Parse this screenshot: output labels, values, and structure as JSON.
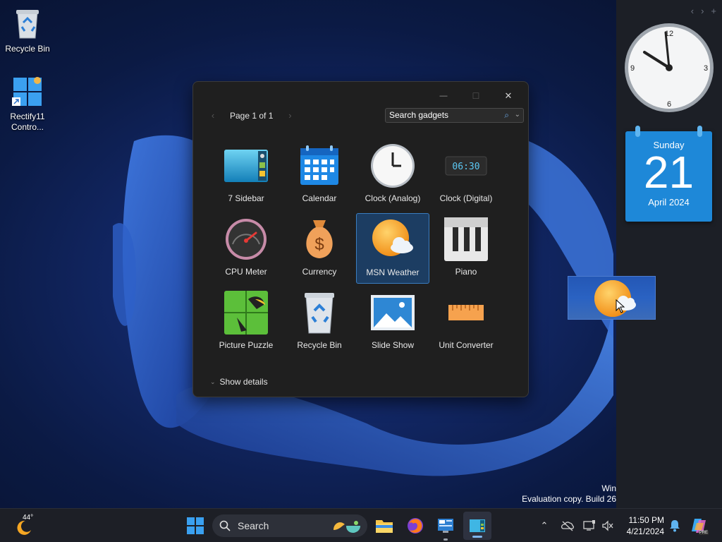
{
  "desktop": {
    "icons": [
      {
        "label": "Recycle Bin"
      },
      {
        "label": "Rectify11 Contro..."
      }
    ],
    "watermark": {
      "line1": "Win",
      "line2": "Evaluation copy. Build 26"
    }
  },
  "sidebar": {
    "nav": [
      "‹",
      "›",
      "+"
    ],
    "clock": {
      "n12": "12",
      "n3": "3",
      "n6": "6",
      "n9": "9"
    },
    "calendar": {
      "weekday": "Sunday",
      "day": "21",
      "month_year": "April 2024"
    }
  },
  "gallery": {
    "window_buttons": {
      "minimize": "—",
      "maximize": "☐",
      "close": "✕"
    },
    "pager": {
      "prev": "‹",
      "text": "Page 1 of 1",
      "next": "›"
    },
    "search": {
      "value": "Search gadgets"
    },
    "items": [
      {
        "label": "7 Sidebar",
        "icon": "sidebar-icon"
      },
      {
        "label": "Calendar",
        "icon": "calendar-icon"
      },
      {
        "label": "Clock (Analog)",
        "icon": "analog-clock-icon"
      },
      {
        "label": "Clock (Digital)",
        "icon": "digital-clock-icon"
      },
      {
        "label": "CPU Meter",
        "icon": "cpu-meter-icon"
      },
      {
        "label": "Currency",
        "icon": "currency-icon"
      },
      {
        "label": "MSN Weather",
        "icon": "weather-icon",
        "selected": true
      },
      {
        "label": "Piano",
        "icon": "piano-icon"
      },
      {
        "label": "Picture Puzzle",
        "icon": "puzzle-icon"
      },
      {
        "label": "Recycle Bin",
        "icon": "recycle-bin-icon"
      },
      {
        "label": "Slide Show",
        "icon": "slide-show-icon"
      },
      {
        "label": "Unit Converter",
        "icon": "ruler-icon"
      }
    ],
    "digital_clock_display": "06:30",
    "show_details": "Show details"
  },
  "taskbar": {
    "weather_temp": "44°",
    "search_label": "Search",
    "time": "11:50 PM",
    "date": "4/21/2024",
    "copilot_badge": "PRE"
  },
  "colors": {
    "accent": "#3a7dc0",
    "calendar": "#1e88d8",
    "taskbar": "#1d1f26"
  }
}
